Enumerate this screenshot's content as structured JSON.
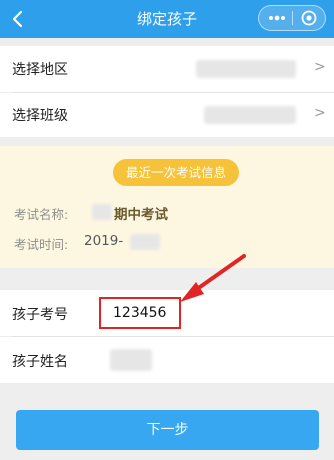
{
  "header": {
    "title": "绑定孩子",
    "back_icon": "chevron-left-icon",
    "more_icon": "more-dots-icon",
    "close_icon": "target-close-icon"
  },
  "selects": {
    "region_label": "选择地区",
    "class_label": "选择班级",
    "chevron": ">"
  },
  "exam": {
    "badge": "最近一次考试信息",
    "name_label": "考试名称:",
    "name_value": "期中考试",
    "time_label": "考试时间:",
    "time_value": "2019-"
  },
  "child": {
    "number_label": "孩子考号",
    "number_value": "123456",
    "name_label": "孩子姓名"
  },
  "actions": {
    "next_label": "下一步"
  },
  "colors": {
    "nav_bar": "#2e9fea",
    "badge": "#f6c23a",
    "highlight": "#e02525",
    "button": "#36a7f0"
  }
}
